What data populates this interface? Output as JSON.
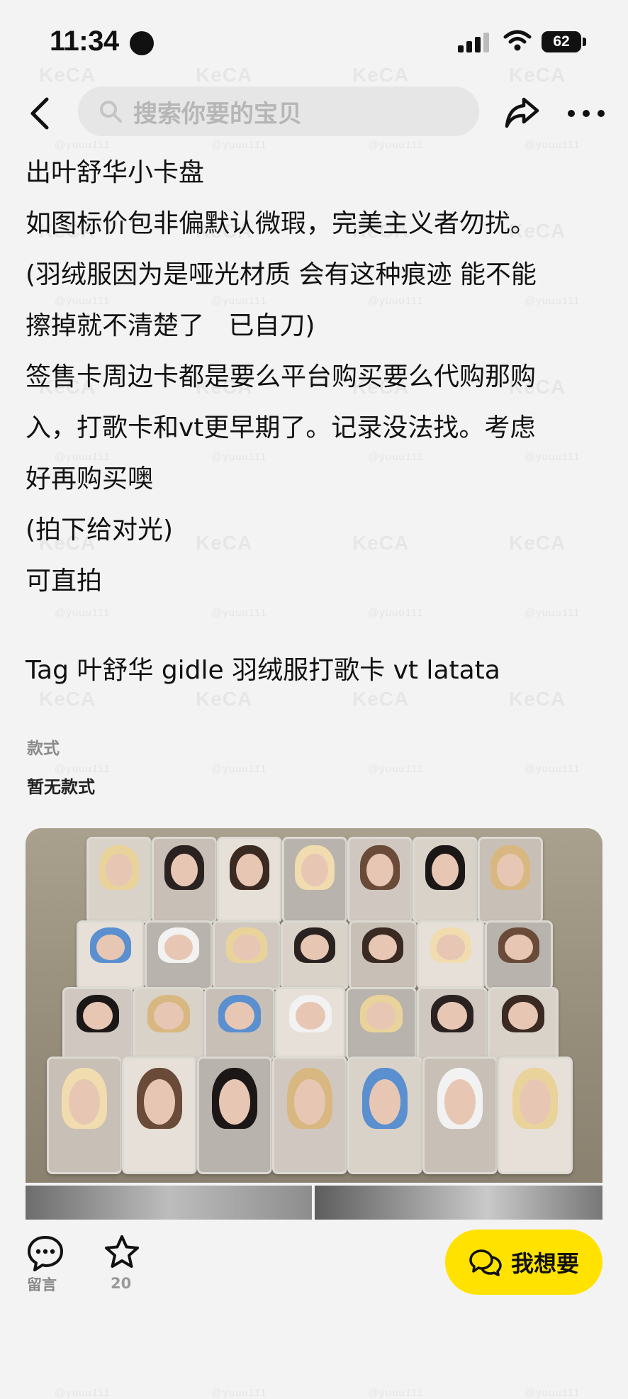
{
  "status_bar": {
    "time": "11:34",
    "battery": "62"
  },
  "watermark": {
    "brand": "KeCA",
    "handle": "@yuuu111"
  },
  "nav": {
    "search_placeholder": "搜索你要的宝贝"
  },
  "post": {
    "lines": [
      "出叶舒华小卡盘",
      "如图标价包非偏默认微瑕，完美主义者勿扰。",
      "(羽绒服因为是哑光材质 会有这种痕迹 能不能",
      "擦掉就不清楚了   已自刀)",
      "签售卡周边卡都是要么平台购买要么代购那购",
      "入，打歌卡和vt更早期了。记录没法找。考虑",
      "好再购买噢",
      "(拍下给对光)",
      "可直拍"
    ],
    "tags": "Tag 叶舒华 gidle 羽绒服打歌卡 vt latata"
  },
  "style": {
    "label": "款式",
    "value": "暂无款式"
  },
  "bottom": {
    "comment_label": "留言",
    "favorite_count": "20",
    "want_label": "我想要"
  },
  "colors": {
    "accent": "#ffe200",
    "background": "#f3f3f3"
  },
  "icons": [
    "back-arrow-icon",
    "search-icon",
    "share-icon",
    "more-icon",
    "comment-icon",
    "star-icon",
    "chat-icon"
  ]
}
